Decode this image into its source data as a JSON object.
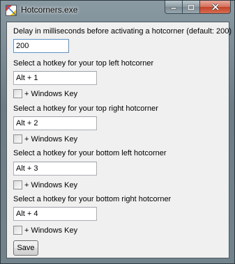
{
  "window": {
    "title": "Hotcorners.exe",
    "min_glyph": "–",
    "max_glyph": "□",
    "close_glyph": "✕"
  },
  "form": {
    "delay_label": "Delay in milliseconds before activating a hotcorner (default: 200)",
    "delay_value": "200",
    "top_left_label": "Select a hotkey for your top left hotcorner",
    "top_left_value": "Alt + 1",
    "top_right_label": "Select a hotkey for your top right hotcorner",
    "top_right_value": "Alt + 2",
    "bottom_left_label": "Select a hotkey for your bottom left hotcorner",
    "bottom_left_value": "Alt + 3",
    "bottom_right_label": "Select a hotkey for your bottom right hotcorner",
    "bottom_right_value": "Alt + 4",
    "windows_key_label": "+ Windows Key",
    "save_label": "Save"
  },
  "icons": {
    "app": "hotcorners-app-icon",
    "minimize": "minimize-icon",
    "maximize": "maximize-icon",
    "close": "close-icon"
  },
  "colors": {
    "title_bar": "#7f8f98",
    "client_bg": "#f0f0f0",
    "close_button": "#c8492f",
    "focused_field_border": "#5c93c7"
  }
}
